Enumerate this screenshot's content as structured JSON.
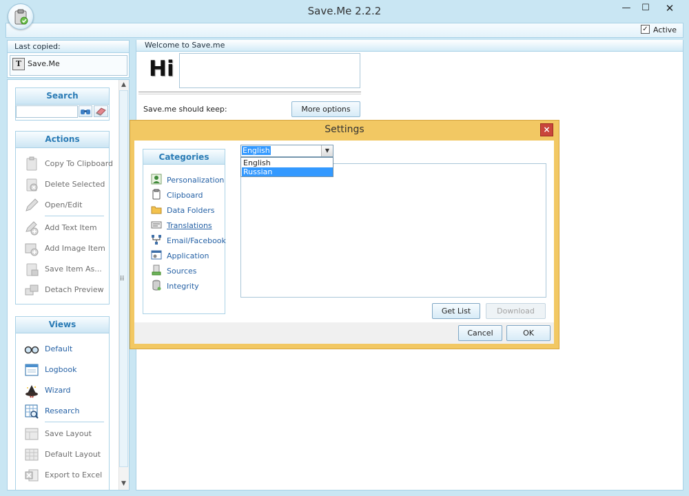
{
  "window": {
    "title": "Save.Me 2.2.2",
    "minimize": "—",
    "maximize": "☐",
    "close": "✕"
  },
  "toolbar": {
    "active_label": "Active",
    "active_checked": true,
    "check_mark": "✓"
  },
  "last_copied": {
    "header": "Last copied:",
    "item_text": "Save.Me",
    "item_icon": "T"
  },
  "search": {
    "title": "Search",
    "value": ""
  },
  "actions": {
    "title": "Actions",
    "items": [
      {
        "label": "Copy To Clipboard",
        "icon": "clipboard-icon"
      },
      {
        "label": "Delete Selected",
        "icon": "delete-icon"
      },
      {
        "label": "Open/Edit",
        "icon": "pen-icon"
      },
      {
        "label": "Add Text Item",
        "icon": "add-text-icon"
      },
      {
        "label": "Add Image Item",
        "icon": "add-image-icon"
      },
      {
        "label": "Save Item As...",
        "icon": "save-item-icon"
      },
      {
        "label": "Detach Preview",
        "icon": "detach-icon"
      }
    ]
  },
  "views": {
    "title": "Views",
    "items": [
      {
        "label": "Default",
        "icon": "glasses-icon"
      },
      {
        "label": "Logbook",
        "icon": "logbook-icon"
      },
      {
        "label": "Wizard",
        "icon": "wizard-icon"
      },
      {
        "label": "Research",
        "icon": "research-icon"
      },
      {
        "label": "Save Layout",
        "icon": "save-layout-icon"
      },
      {
        "label": "Default Layout",
        "icon": "default-layout-icon"
      },
      {
        "label": "Export to Excel",
        "icon": "excel-icon"
      }
    ]
  },
  "main": {
    "welcome": "Welcome to Save.me",
    "hi": "Hi",
    "keep_label": "Save.me should keep:",
    "more_options": "More options"
  },
  "settings": {
    "title": "Settings",
    "close": "×",
    "categories_title": "Categories",
    "categories": [
      {
        "label": "Personalization",
        "icon": "person-icon"
      },
      {
        "label": "Clipboard",
        "icon": "clipboard-icon"
      },
      {
        "label": "Data Folders",
        "icon": "folder-icon"
      },
      {
        "label": "Translations",
        "icon": "translation-icon"
      },
      {
        "label": "Email/Facebook",
        "icon": "network-icon"
      },
      {
        "label": "Application",
        "icon": "application-icon"
      },
      {
        "label": "Sources",
        "icon": "sources-icon"
      },
      {
        "label": "Integrity",
        "icon": "database-icon"
      }
    ],
    "language": {
      "selected": "English",
      "options": [
        "English",
        "Russian"
      ],
      "highlighted": "Russian"
    },
    "buttons": {
      "get_list": "Get List",
      "download": "Download",
      "cancel": "Cancel",
      "ok": "OK"
    }
  }
}
